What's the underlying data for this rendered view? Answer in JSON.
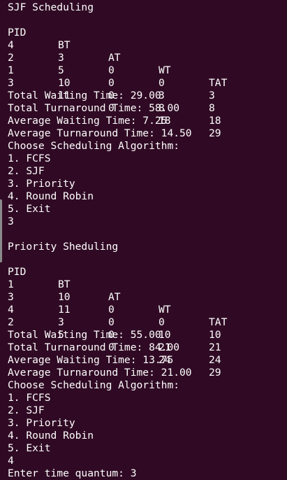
{
  "colors": {
    "background": "#300a24",
    "text": "#ffffff"
  },
  "sjf": {
    "title": "SJF Scheduling",
    "headers": [
      "PID",
      "BT",
      "AT",
      "WT",
      "TAT"
    ],
    "rows": [
      [
        "4",
        "3",
        "0",
        "0",
        "3"
      ],
      [
        "2",
        "5",
        "0",
        "3",
        "8"
      ],
      [
        "1",
        "10",
        "0",
        "8",
        "18"
      ],
      [
        "3",
        "11",
        "0",
        "18",
        "29"
      ]
    ],
    "total_waiting": "Total Waiting Time: 29.00",
    "total_turnaround": "Total Turnaround Time: 58.00",
    "avg_waiting": "Average Waiting Time: 7.25",
    "avg_turnaround": "Average Turnaround Time: 14.50"
  },
  "menu1": {
    "prompt": "Choose Scheduling Algorithm:",
    "options": [
      "1. FCFS",
      "2. SJF",
      "3. Priority",
      "4. Round Robin",
      "5. Exit"
    ],
    "input": "3"
  },
  "priority": {
    "title": "Priority Sheduling",
    "headers": [
      "PID",
      "BT",
      "AT",
      "WT",
      "TAT"
    ],
    "rows": [
      [
        "1",
        "10",
        "0",
        "0",
        "10"
      ],
      [
        "3",
        "11",
        "0",
        "10",
        "21"
      ],
      [
        "4",
        "3",
        "0",
        "21",
        "24"
      ],
      [
        "2",
        "5",
        "0",
        "24",
        "29"
      ]
    ],
    "total_waiting": "Total Waiting Time: 55.00",
    "total_turnaround": "Total Turnaround Time: 84.00",
    "avg_waiting": "Average Waiting Time: 13.75",
    "avg_turnaround": "Average Turnaround Time: 21.00"
  },
  "menu2": {
    "prompt": "Choose Scheduling Algorithm:",
    "options": [
      "1. FCFS",
      "2. SJF",
      "3. Priority",
      "4. Round Robin",
      "5. Exit"
    ],
    "input": "4"
  },
  "quantum_prompt": "Enter time quantum: 3"
}
